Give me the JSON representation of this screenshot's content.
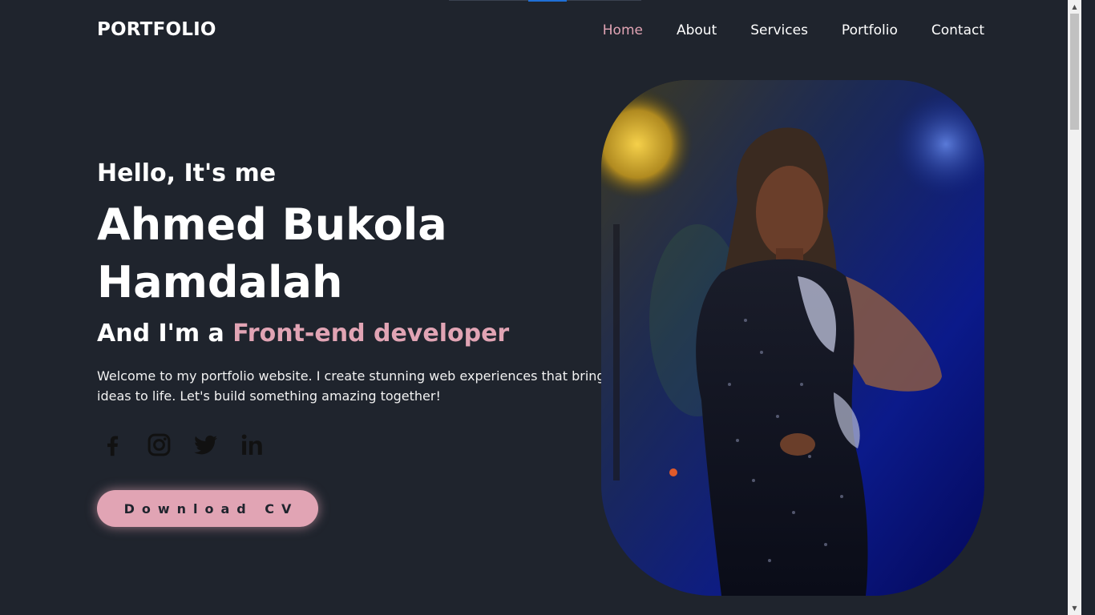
{
  "header": {
    "logo": "PORTFOLIO",
    "nav": [
      {
        "label": "Home",
        "active": true
      },
      {
        "label": "About",
        "active": false
      },
      {
        "label": "Services",
        "active": false
      },
      {
        "label": "Portfolio",
        "active": false
      },
      {
        "label": "Contact",
        "active": false
      }
    ]
  },
  "hero": {
    "greeting": "Hello, It's me",
    "name": "Ahmed Bukola Hamdalah",
    "role_prefix": "And I'm a ",
    "role_highlight": "Front-end developer",
    "intro": "Welcome to my portfolio website. I create stunning web experiences that bring ideas to life. Let's build something amazing together!",
    "cv_button": "Download CV"
  },
  "socials": [
    {
      "icon": "facebook-icon"
    },
    {
      "icon": "instagram-icon"
    },
    {
      "icon": "twitter-icon"
    },
    {
      "icon": "linkedin-icon"
    }
  ],
  "colors": {
    "background": "#1f242d",
    "accent": "#e1a4b4",
    "text": "#ffffff"
  }
}
